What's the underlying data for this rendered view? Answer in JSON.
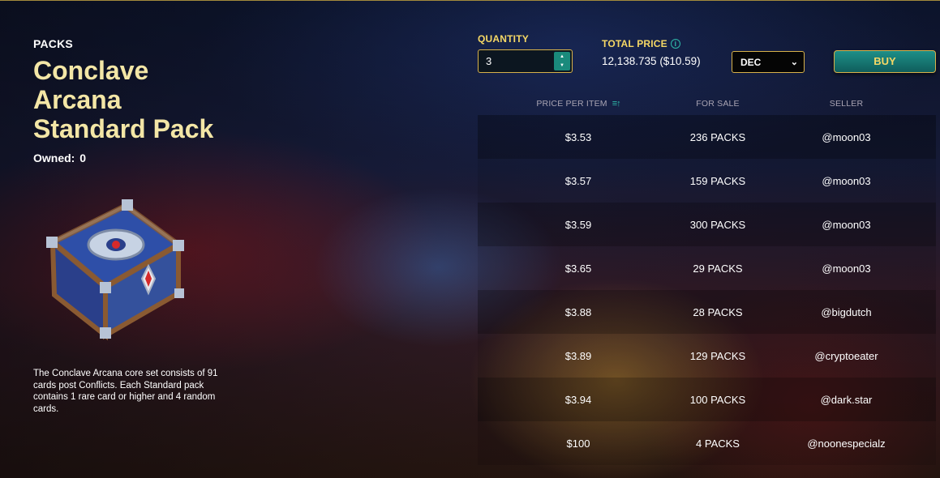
{
  "pack": {
    "category": "PACKS",
    "title": "Conclave Arcana Standard Pack",
    "owned_label": "Owned:",
    "owned_value": "0",
    "description": "The Conclave Arcana core set consists of 91 cards post Conflicts. Each Standard pack contains 1 rare card or higher and 4 random cards."
  },
  "purchase": {
    "quantity_label": "QUANTITY",
    "quantity_value": "3",
    "total_label": "TOTAL PRICE",
    "total_value": "12,138.735 ($10.59)",
    "currency": "DEC",
    "buy_label": "BUY"
  },
  "listings": {
    "headers": {
      "price": "PRICE PER ITEM",
      "for_sale": "FOR SALE",
      "seller": "SELLER"
    },
    "rows": [
      {
        "price": "$3.53",
        "for_sale": "236 PACKS",
        "seller": "@moon03"
      },
      {
        "price": "$3.57",
        "for_sale": "159 PACKS",
        "seller": "@moon03"
      },
      {
        "price": "$3.59",
        "for_sale": "300 PACKS",
        "seller": "@moon03"
      },
      {
        "price": "$3.65",
        "for_sale": "29 PACKS",
        "seller": "@moon03"
      },
      {
        "price": "$3.88",
        "for_sale": "28 PACKS",
        "seller": "@bigdutch"
      },
      {
        "price": "$3.89",
        "for_sale": "129 PACKS",
        "seller": "@cryptoeater"
      },
      {
        "price": "$3.94",
        "for_sale": "100 PACKS",
        "seller": "@dark.star"
      },
      {
        "price": "$100",
        "for_sale": "4 PACKS",
        "seller": "@noonespecialz"
      }
    ]
  },
  "icons": {
    "info": "info-icon",
    "sort": "sort-ascending-icon",
    "stepper": "up-down-arrows-icon",
    "dropdown": "chevron-down-icon"
  },
  "colors": {
    "gold_title": "#f3e6a6",
    "gold_label": "#f6d865",
    "teal_accent": "#1a8a7c"
  }
}
